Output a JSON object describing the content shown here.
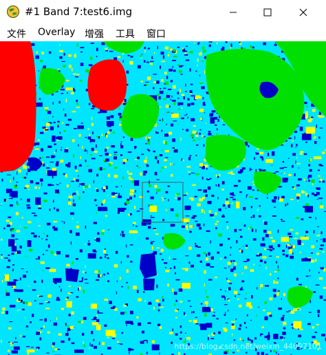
{
  "window": {
    "title": "#1 Band 7:test6.img",
    "icon": "envi-globe-icon"
  },
  "controls": {
    "minimize_icon": "minimize-icon",
    "maximize_icon": "maximize-icon",
    "close_icon": "close-icon"
  },
  "menu": {
    "items": [
      "文件",
      "Overlay",
      "增强",
      "工具",
      "窗口"
    ]
  },
  "image": {
    "classes": [
      {
        "color": "#00e5ff"
      },
      {
        "color": "#0000c8"
      },
      {
        "color": "#ffff00"
      },
      {
        "color": "#00e000"
      },
      {
        "color": "#ff0000"
      }
    ],
    "watermark": "https://blog.csdn.net/weixin_44097101"
  }
}
